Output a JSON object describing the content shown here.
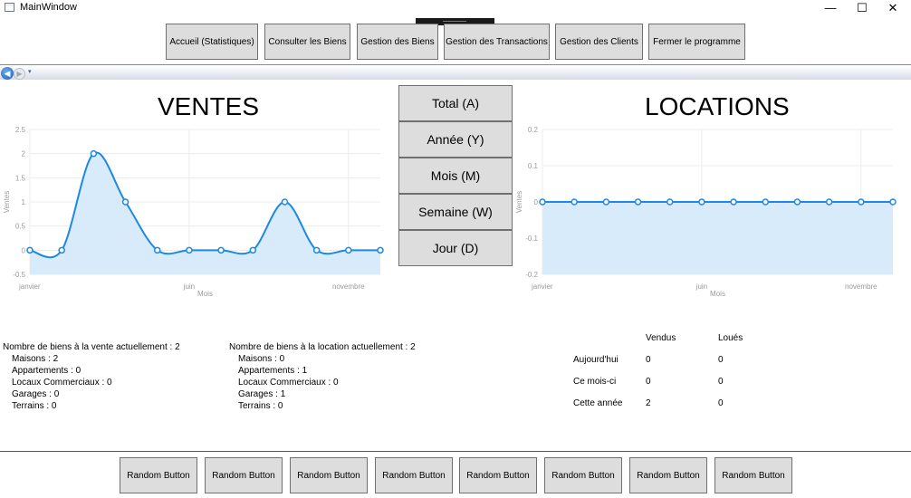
{
  "window": {
    "title": "MainWindow",
    "minimize_glyph": "—",
    "maximize_glyph": "☐",
    "close_glyph": "✕"
  },
  "nav": {
    "buttons": [
      "Accueil (Statistiques)",
      "Consulter les Biens",
      "Gestion des Biens",
      "Gestion des Transactions",
      "Gestion des Clients",
      "Fermer le programme"
    ],
    "back_glyph": "◀",
    "forward_glyph": "▶",
    "menu_glyph": "▾"
  },
  "period_buttons": [
    "Total (A)",
    "Année (Y)",
    "Mois (M)",
    "Semaine (W)",
    "Jour (D)"
  ],
  "chart_data": [
    {
      "type": "area",
      "title": "VENTES",
      "xlabel": "Mois",
      "ylabel": "Ventes",
      "x_ticks": [
        "janvier",
        "juin",
        "novembre"
      ],
      "x_tick_indices": [
        0,
        5,
        10
      ],
      "values": [
        0,
        0,
        2,
        1,
        0,
        0,
        0,
        0,
        1,
        0,
        0,
        0
      ],
      "ylim": [
        -0.5,
        2.5
      ],
      "yticks": [
        "2.5",
        "2",
        "1.5",
        "1",
        "0.5",
        "0",
        "-0.5"
      ],
      "ytick_values": [
        2.5,
        2,
        1.5,
        1,
        0.5,
        0,
        -0.5
      ],
      "grid": true,
      "line_color": "#1e88e5",
      "fill_color": "#d7ebfb"
    },
    {
      "type": "area",
      "title": "LOCATIONS",
      "xlabel": "Mois",
      "ylabel": "Ventes",
      "x_ticks": [
        "janvier",
        "juin",
        "novembre"
      ],
      "x_tick_indices": [
        0,
        5,
        10
      ],
      "values": [
        0,
        0,
        0,
        0,
        0,
        0,
        0,
        0,
        0,
        0,
        0,
        0
      ],
      "ylim": [
        -0.2,
        0.2
      ],
      "yticks": [
        "0.2",
        "0.1",
        "0",
        "-0.1",
        "-0.2"
      ],
      "ytick_values": [
        0.2,
        0.1,
        0,
        -0.1,
        -0.2
      ],
      "grid": true,
      "line_color": "#1e88e5",
      "fill_color": "#d7ebfb"
    }
  ],
  "stats_sale": {
    "heading": "Nombre de biens à la vente actuellement : 2",
    "items": [
      "Maisons : 2",
      "Appartements : 0",
      "Locaux Commerciaux : 0",
      "Garages : 0",
      "Terrains : 0"
    ]
  },
  "stats_rent": {
    "heading": "Nombre de biens à la location actuellement : 2",
    "items": [
      "Maisons : 0",
      "Appartements : 1",
      "Locaux Commerciaux : 0",
      "Garages : 1",
      "Terrains : 0"
    ]
  },
  "summary_table": {
    "headers": [
      "Vendus",
      "Loués"
    ],
    "rows": [
      {
        "label": "Aujourd'hui",
        "vendus": "0",
        "loues": "0"
      },
      {
        "label": "Ce mois-ci",
        "vendus": "0",
        "loues": "0"
      },
      {
        "label": "Cette année",
        "vendus": "2",
        "loues": "0"
      }
    ]
  },
  "bottom_buttons": [
    "Random Button",
    "Random Button",
    "Random Button",
    "Random Button",
    "Random Button",
    "Random Button",
    "Random Button",
    "Random Button"
  ]
}
